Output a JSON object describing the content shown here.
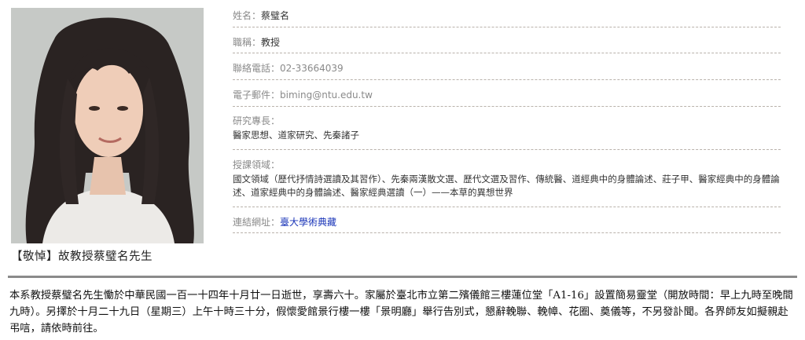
{
  "portrait": {
    "alt": "portrait-photo"
  },
  "caption": "【敬悼】故教授蔡璧名先生",
  "fields": {
    "name": {
      "label": "姓名：",
      "value": "蔡璧名"
    },
    "title": {
      "label": "職稱：",
      "value": "教授"
    },
    "phone": {
      "label": "聯絡電話：",
      "value": "02-33664039"
    },
    "email": {
      "label": "電子郵件：",
      "value": "biming@ntu.edu.tw"
    },
    "expertise": {
      "label": "研究專長：",
      "value": "醫家思想、道家研究、先秦諸子"
    },
    "courses": {
      "label": "授課領域：",
      "value": "國文領域（歷代抒情詩選讀及其習作）、先秦兩漢散文選、歷代文選及習作、傳統醫、道經典中的身體論述、莊子甲、醫家經典中的身體論述、道家經典中的身體論述、醫家經典選讀（一）——本草的異想世界"
    },
    "link": {
      "label": "連結網址：",
      "value": "臺大學術典藏"
    }
  },
  "description": "本系教授蔡璧名先生慟於中華民國一百一十四年十月廿一日逝世，享壽六十。家屬於臺北市立第二殯儀館三樓蓮位堂「A1-16」設置簡易靈堂（開放時間：早上九時至晚間九時）。另擇於十月二十九日（星期三）上午十時三十分，假懷愛館景行樓一樓「景明廳」舉行告別式，懇辭輓聯、輓幛、花圈、奠儀等，不另發訃聞。各界師友如擬親赴弔唁，請依時前往。",
  "colors": {
    "label": "#8a8a8a",
    "link": "#1a35b8",
    "divider": "#8a8a8a"
  }
}
